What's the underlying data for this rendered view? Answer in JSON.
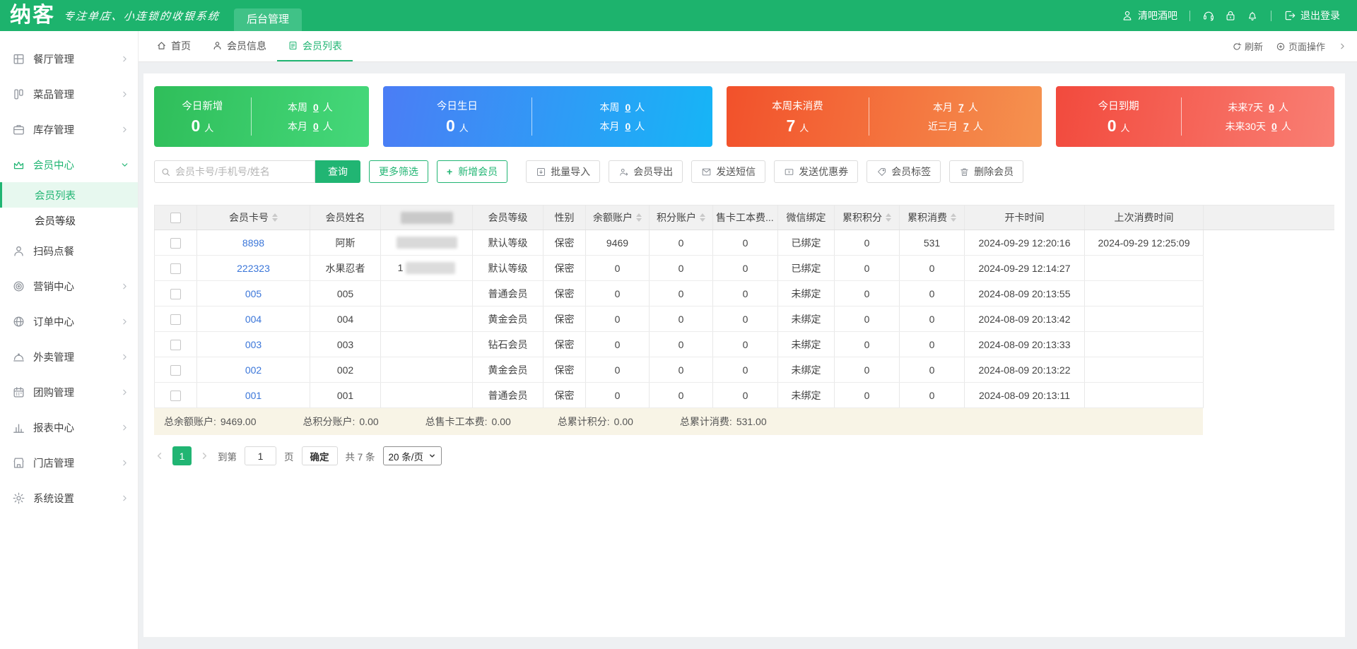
{
  "colors": {
    "brand_green": "#1db36d",
    "accent_green": "#21b573",
    "link_blue": "#3b76d9",
    "summary_bg": "#f8f4e6"
  },
  "topbar": {
    "logo": "纳客",
    "tagline": "专注单店、小连锁的收银系统",
    "admin_tab": "后台管理",
    "user_name": "清吧酒吧",
    "logout_label": "退出登录"
  },
  "sidebar": {
    "items": [
      {
        "label": "餐厅管理"
      },
      {
        "label": "菜品管理"
      },
      {
        "label": "库存管理"
      },
      {
        "label": "会员中心"
      },
      {
        "label": "扫码点餐"
      },
      {
        "label": "营销中心"
      },
      {
        "label": "订单中心"
      },
      {
        "label": "外卖管理"
      },
      {
        "label": "团购管理"
      },
      {
        "label": "报表中心"
      },
      {
        "label": "门店管理"
      },
      {
        "label": "系统设置"
      }
    ],
    "submenu": [
      {
        "label": "会员列表"
      },
      {
        "label": "会员等级"
      }
    ]
  },
  "tabbar": {
    "tabs": [
      {
        "label": "首页"
      },
      {
        "label": "会员信息"
      },
      {
        "label": "会员列表"
      }
    ],
    "refresh_label": "刷新",
    "page_actions_label": "页面操作"
  },
  "stat_cards": [
    {
      "title": "今日新增",
      "value": "0",
      "unit": "人",
      "rows": [
        {
          "label": "本周",
          "value": "0",
          "unit": "人"
        },
        {
          "label": "本月",
          "value": "0",
          "unit": "人"
        }
      ],
      "colors": [
        "#2fbe5a",
        "#45d87a"
      ]
    },
    {
      "title": "今日生日",
      "value": "0",
      "unit": "人",
      "rows": [
        {
          "label": "本周",
          "value": "0",
          "unit": "人"
        },
        {
          "label": "本月",
          "value": "0",
          "unit": "人"
        }
      ],
      "colors": [
        "#4b7df5",
        "#16b5f6"
      ]
    },
    {
      "title": "本周未消费",
      "value": "7",
      "unit": "人",
      "rows": [
        {
          "label": "本月",
          "value": "7",
          "unit": "人"
        },
        {
          "label": "近三月",
          "value": "7",
          "unit": "人"
        }
      ],
      "colors": [
        "#f2512b",
        "#f5924f"
      ]
    },
    {
      "title": "今日到期",
      "value": "0",
      "unit": "人",
      "rows": [
        {
          "label": "未来7天",
          "value": "0",
          "unit": "人"
        },
        {
          "label": "未来30天",
          "value": "0",
          "unit": "人"
        }
      ],
      "colors": [
        "#f24a3d",
        "#f97f74"
      ]
    }
  ],
  "toolbar": {
    "search_placeholder": "会员卡号/手机号/姓名",
    "search_button": "查询",
    "more_filter": "更多筛选",
    "add_plus": "+",
    "add_member": "新增会员",
    "actions": [
      {
        "label": "批量导入"
      },
      {
        "label": "会员导出"
      },
      {
        "label": "发送短信"
      },
      {
        "label": "发送优惠券"
      },
      {
        "label": "会员标签"
      },
      {
        "label": "删除会员"
      }
    ]
  },
  "table": {
    "columns": [
      {
        "label": "会员卡号",
        "sortable": true
      },
      {
        "label": "会员姓名",
        "sortable": false
      },
      {
        "label": "",
        "sortable": false
      },
      {
        "label": "会员等级",
        "sortable": false
      },
      {
        "label": "性别",
        "sortable": false
      },
      {
        "label": "余额账户",
        "sortable": true
      },
      {
        "label": "积分账户",
        "sortable": true
      },
      {
        "label": "售卡工本费...",
        "sortable": true
      },
      {
        "label": "微信绑定",
        "sortable": false
      },
      {
        "label": "累积积分",
        "sortable": true
      },
      {
        "label": "累积消费",
        "sortable": true
      },
      {
        "label": "开卡时间",
        "sortable": false
      },
      {
        "label": "上次消费时间",
        "sortable": false
      }
    ],
    "rows": [
      {
        "card_no": "8898",
        "name": "阿斯",
        "phone_prefix": "",
        "level": "默认等级",
        "gender": "保密",
        "balance": "9469",
        "points": "0",
        "card_fee": "0",
        "wechat": "已绑定",
        "acc_points": "0",
        "acc_consume": "531",
        "open_time": "2024-09-29 12:20:16",
        "last_time": "2024-09-29 12:25:09"
      },
      {
        "card_no": "222323",
        "name": "水果忍者",
        "phone_prefix": "1",
        "level": "默认等级",
        "gender": "保密",
        "balance": "0",
        "points": "0",
        "card_fee": "0",
        "wechat": "已绑定",
        "acc_points": "0",
        "acc_consume": "0",
        "open_time": "2024-09-29 12:14:27",
        "last_time": ""
      },
      {
        "card_no": "005",
        "name": "005",
        "phone_prefix": "",
        "level": "普通会员",
        "gender": "保密",
        "balance": "0",
        "points": "0",
        "card_fee": "0",
        "wechat": "未绑定",
        "acc_points": "0",
        "acc_consume": "0",
        "open_time": "2024-08-09 20:13:55",
        "last_time": ""
      },
      {
        "card_no": "004",
        "name": "004",
        "phone_prefix": "",
        "level": "黄金会员",
        "gender": "保密",
        "balance": "0",
        "points": "0",
        "card_fee": "0",
        "wechat": "未绑定",
        "acc_points": "0",
        "acc_consume": "0",
        "open_time": "2024-08-09 20:13:42",
        "last_time": ""
      },
      {
        "card_no": "003",
        "name": "003",
        "phone_prefix": "",
        "level": "钻石会员",
        "gender": "保密",
        "balance": "0",
        "points": "0",
        "card_fee": "0",
        "wechat": "未绑定",
        "acc_points": "0",
        "acc_consume": "0",
        "open_time": "2024-08-09 20:13:33",
        "last_time": ""
      },
      {
        "card_no": "002",
        "name": "002",
        "phone_prefix": "",
        "level": "黄金会员",
        "gender": "保密",
        "balance": "0",
        "points": "0",
        "card_fee": "0",
        "wechat": "未绑定",
        "acc_points": "0",
        "acc_consume": "0",
        "open_time": "2024-08-09 20:13:22",
        "last_time": ""
      },
      {
        "card_no": "001",
        "name": "001",
        "phone_prefix": "",
        "level": "普通会员",
        "gender": "保密",
        "balance": "0",
        "points": "0",
        "card_fee": "0",
        "wechat": "未绑定",
        "acc_points": "0",
        "acc_consume": "0",
        "open_time": "2024-08-09 20:13:11",
        "last_time": ""
      }
    ]
  },
  "summary": {
    "items": [
      {
        "label": "总余额账户:",
        "value": "9469.00"
      },
      {
        "label": "总积分账户:",
        "value": "0.00"
      },
      {
        "label": "总售卡工本费:",
        "value": "0.00"
      },
      {
        "label": "总累计积分:",
        "value": "0.00"
      },
      {
        "label": "总累计消费:",
        "value": "531.00"
      }
    ]
  },
  "pagination": {
    "current_page": "1",
    "goto_label": "到第",
    "goto_value": "1",
    "page_unit": "页",
    "confirm_label": "确定",
    "total_label": "共 7 条",
    "page_size": "20 条/页"
  }
}
